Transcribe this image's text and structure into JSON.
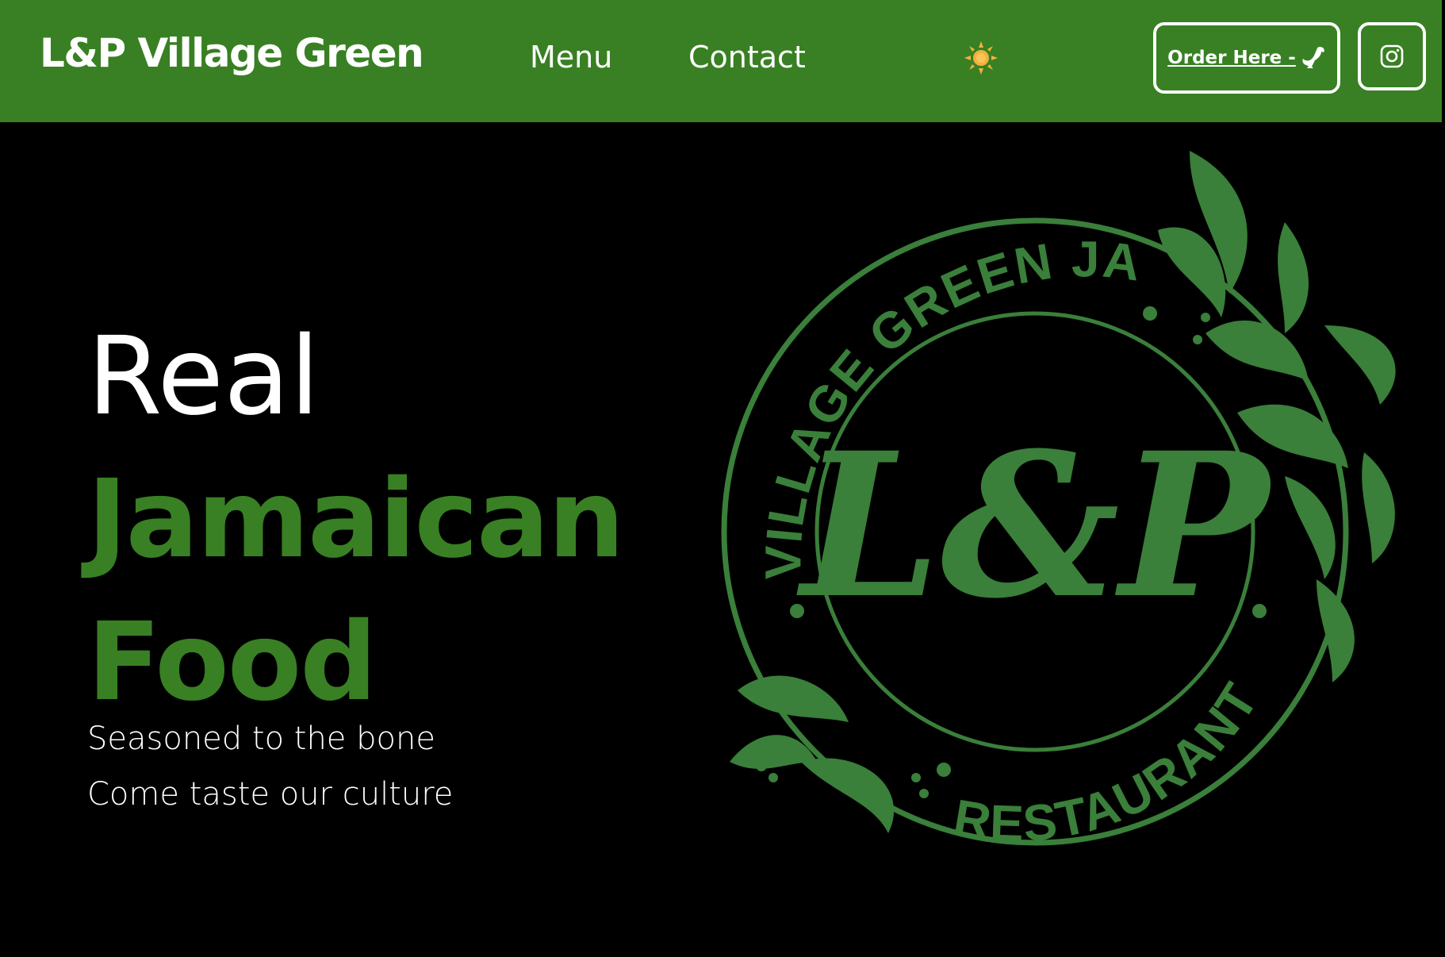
{
  "header": {
    "brand": "L&P Village Green",
    "nav": {
      "menu": "Menu",
      "contact": "Contact"
    },
    "order_label": "Order Here -",
    "order_icon": "rooster-icon",
    "theme_icon": "sun-icon",
    "social_icon": "instagram-icon"
  },
  "hero": {
    "line1": "Real",
    "line2": "Jamaican",
    "line3": "Food",
    "tagline1": "Seasoned to the bone",
    "tagline2": "Come taste our culture"
  },
  "logo": {
    "top_text": "VILLAGE GREEN JAMAICAN",
    "bottom_text": "RESTAURANT",
    "monogram": "L&P"
  },
  "colors": {
    "brand_green": "#388023",
    "logo_green": "#3a7f3a",
    "background": "#000000",
    "text": "#ffffff",
    "sun": "#f2b13c"
  }
}
